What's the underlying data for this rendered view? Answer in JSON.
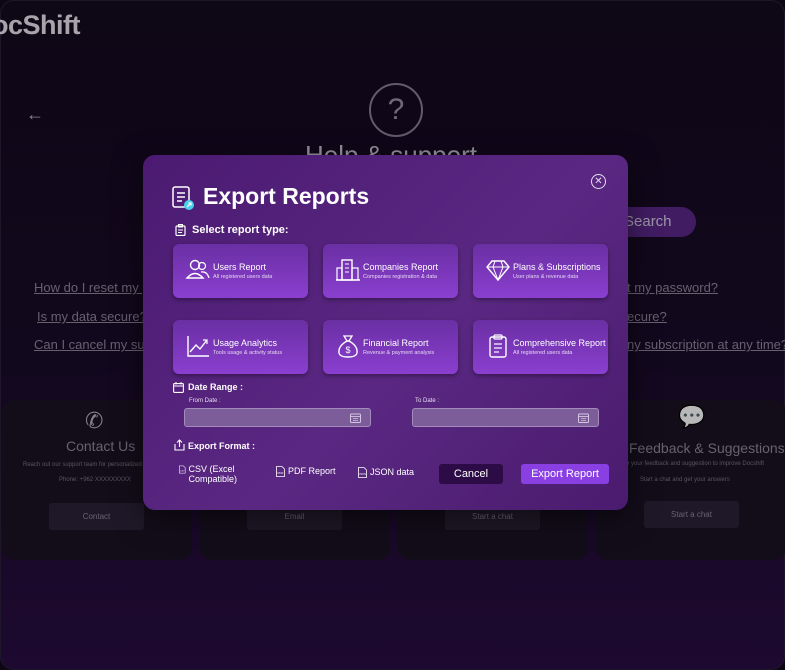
{
  "app": {
    "logo": "ocShift"
  },
  "background": {
    "help_title": "Help & support",
    "search_label": "Search",
    "faq": [
      "How do I reset my pa",
      "Is my data secure?",
      "Can I cancel my subs",
      "t my password?",
      "ecure?",
      "ny subscription at any time?"
    ],
    "cards": [
      {
        "title": "Contact Us",
        "text1": "Reach out our support team for personalized a",
        "text2": "Phone: +962 XXXXXXXXX",
        "button": "Contact"
      },
      {
        "button": "Email"
      },
      {
        "button": "Start a chat"
      },
      {
        "title": "Feedback & Suggestions",
        "text1": "e your feedback and suggestion to improve Docshift",
        "text2": "Start a chat and get your answers",
        "button": "Start a chat"
      }
    ]
  },
  "modal": {
    "title": "Export Reports",
    "select_label": "Select report type:",
    "report_types": [
      {
        "title": "Users Report",
        "subtitle": "All registered users data",
        "icon": "users-icon"
      },
      {
        "title": "Companies Report",
        "subtitle": "Companies registration & data",
        "icon": "building-icon"
      },
      {
        "title": "Plans & Subscriptions",
        "subtitle": "User plans & revenue data",
        "icon": "diamond-icon"
      },
      {
        "title": "Usage Analytics",
        "subtitle": "Tools usage & activity status",
        "icon": "chart-icon"
      },
      {
        "title": "Financial Report",
        "subtitle": "Revenue & payment analysis",
        "icon": "money-bag-icon"
      },
      {
        "title": "Comprehensive Report",
        "subtitle": "All registered users data",
        "icon": "clipboard-icon"
      }
    ],
    "date_range_label": "Date Range :",
    "from_label": "From Date :",
    "to_label": "To Date :",
    "from_value": "",
    "to_value": "",
    "export_format_label": "Export Format :",
    "formats": [
      {
        "label": "CSV (Excel Compatible)",
        "icon_text": "CSV"
      },
      {
        "label": "PDF Report",
        "icon_text": "PDF"
      },
      {
        "label": "JSON data",
        "icon_text": "JSON"
      }
    ],
    "cancel_label": "Cancel",
    "export_label": "Export Report"
  }
}
